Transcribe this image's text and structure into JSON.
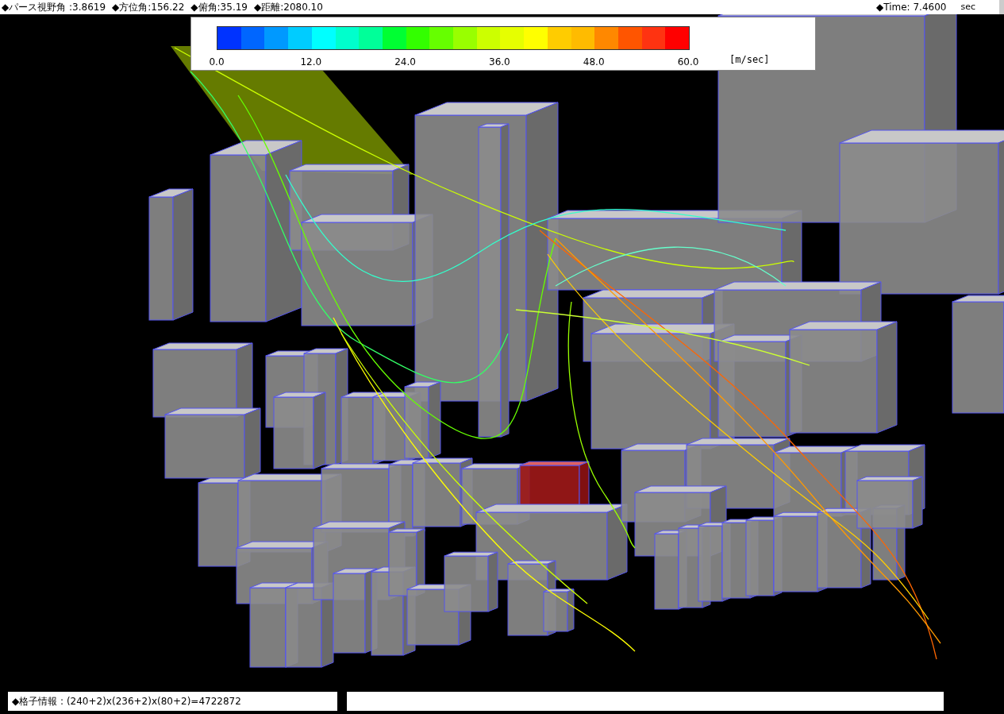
{
  "header": {
    "items": [
      "◆パース視野角 :3.8619",
      "◆方位角:156.22",
      "◆俯角:35.19",
      "◆距離:2080.10"
    ],
    "time": "◆Time: 7.4600",
    "time_unit": "sec"
  },
  "legend": {
    "swatches": [
      {
        "color": "#0033ff"
      },
      {
        "color": "#0066ff"
      },
      {
        "color": "#0099ff"
      },
      {
        "color": "#00ccff"
      },
      {
        "color": "#00ffff"
      },
      {
        "color": "#00ffcc"
      },
      {
        "color": "#00ff99"
      },
      {
        "color": "#00ff33"
      },
      {
        "color": "#33ff00"
      },
      {
        "color": "#66ff00"
      },
      {
        "color": "#99ff00"
      },
      {
        "color": "#ccff00"
      },
      {
        "color": "#e6ff00"
      },
      {
        "color": "#ffff00"
      },
      {
        "color": "#ffcc00"
      },
      {
        "color": "#ffbb00"
      },
      {
        "color": "#ff8800"
      },
      {
        "color": "#ff5500"
      },
      {
        "color": "#ff3311"
      },
      {
        "color": "#ff0000"
      }
    ],
    "ticks": [
      "0.0",
      "12.0",
      "24.0",
      "36.0",
      "48.0",
      "60.0"
    ],
    "unit": "[m/sec]"
  },
  "footer": {
    "grid_info": "◆格子情報 : (240+2)x(236+2)x(80+2)=4722872"
  }
}
